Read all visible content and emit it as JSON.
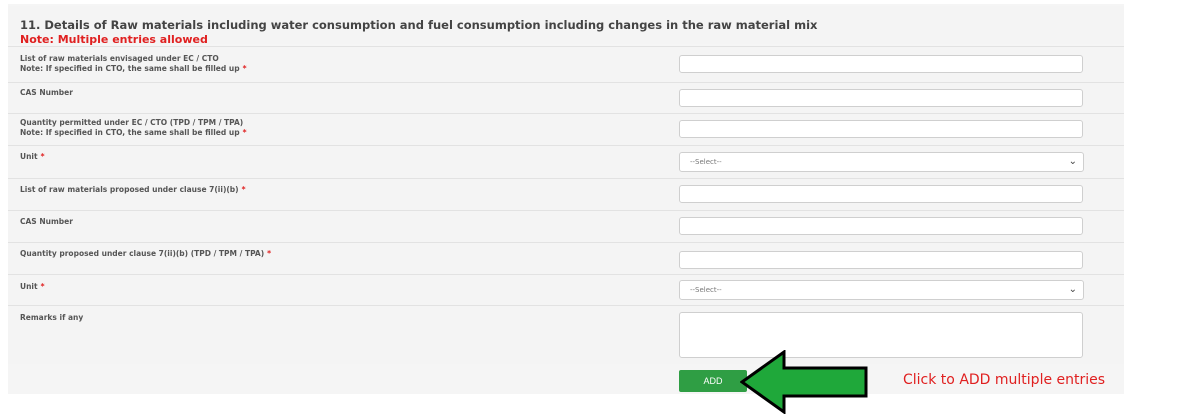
{
  "section": {
    "title": "11. Details of Raw materials including water consumption and fuel consumption including changes in the raw material mix",
    "note": "Note: Multiple entries allowed"
  },
  "fields": [
    {
      "label": "List of raw materials envisaged under EC / CTO",
      "sub": "Note: If specified in CTO, the same shall be filled up",
      "required": "*"
    },
    {
      "label": "CAS Number",
      "sub": "",
      "required": ""
    },
    {
      "label": "Quantity permitted under EC / CTO (TPD / TPM / TPA)",
      "sub": "Note: If specified in CTO, the same shall be filled up",
      "required": "*"
    },
    {
      "label": "Unit",
      "sub": "",
      "required": "*",
      "select": "--Select--"
    },
    {
      "label": "List of raw materials proposed under clause 7(ii)(b)",
      "sub": "",
      "required": "*"
    },
    {
      "label": "CAS Number",
      "sub": "",
      "required": ""
    },
    {
      "label": "Quantity proposed under clause 7(ii)(b) (TPD / TPM / TPA)",
      "sub": "",
      "required": "*"
    },
    {
      "label": "Unit",
      "sub": "",
      "required": "*",
      "select": "--Select--"
    },
    {
      "label": "Remarks if any",
      "sub": "",
      "required": ""
    }
  ],
  "buttons": {
    "add": "ADD"
  },
  "annotation": {
    "hint": "Click to ADD multiple entries",
    "arrow_color": "#1fa83a"
  },
  "icons": {
    "select_chevron": "chevron-down-icon",
    "arrow": "arrow-left-icon"
  }
}
